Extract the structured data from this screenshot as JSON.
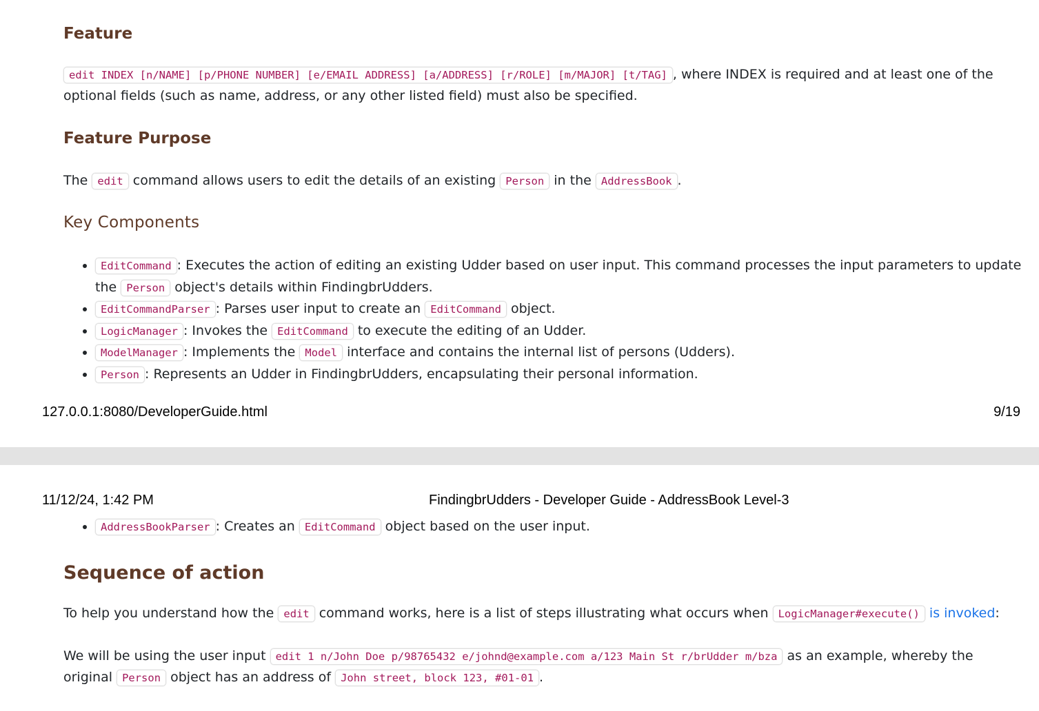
{
  "page1": {
    "feature_heading": "Feature",
    "feature_code": "edit INDEX [n/NAME] [p/PHONE NUMBER] [e/EMAIL ADDRESS] [a/ADDRESS] [r/ROLE] [m/MAJOR] [t/TAG]",
    "feature_text": ", where INDEX is required and at least one of the optional fields (such as name, address, or any other listed field) must also be specified.",
    "purpose_heading": "Feature Purpose",
    "purpose": {
      "t1": "The ",
      "c1": "edit",
      "t2": " command allows users to edit the details of an existing ",
      "c2": "Person",
      "t3": " in the ",
      "c3": "AddressBook",
      "t4": "."
    },
    "key_heading": "Key Components",
    "key_items": [
      {
        "c1": "EditCommand",
        "t1": ": Executes the action of editing an existing Udder based on user input. This command processes the input parameters to update the ",
        "c2": "Person",
        "t2": " object's details within FindingbrUdders."
      },
      {
        "c1": "EditCommandParser",
        "t1": ": Parses user input to create an ",
        "c2": "EditCommand",
        "t2": " object."
      },
      {
        "c1": "LogicManager",
        "t1": ": Invokes the ",
        "c2": "EditCommand",
        "t2": " to execute the editing of an Udder."
      },
      {
        "c1": "ModelManager",
        "t1": ": Implements the ",
        "c2": "Model",
        "t2": " interface and contains the internal list of persons (Udders)."
      },
      {
        "c1": "Person",
        "t1": ": Represents an Udder in FindingbrUdders, encapsulating their personal information."
      }
    ],
    "footer_url": "127.0.0.1:8080/DeveloperGuide.html",
    "footer_page": "9/19"
  },
  "page2": {
    "header_datetime": "11/12/24, 1:42 PM",
    "header_title": "FindingbrUdders - Developer Guide - AddressBook Level-3",
    "key_item": {
      "c1": "AddressBookParser",
      "t1": ": Creates an ",
      "c2": "EditCommand",
      "t2": " object based on the user input."
    },
    "sequence_heading": "Sequence of action",
    "seq_p1": {
      "t1": "To help you understand how the ",
      "c1": "edit",
      "t2": " command works, here is a list of steps illustrating what occurs when ",
      "c2": "LogicManager#execute()",
      "link": " is invoked",
      "t3": ":"
    },
    "seq_p2": {
      "t1": "We will be using the user input ",
      "c1": "edit 1 n/John Doe p/98765432 e/johnd@example.com a/123 Main St r/brUdder m/bza",
      "t2": " as an example, whereby the original ",
      "c2": "Person",
      "t3": " object has an address of ",
      "c3": "John street, block 123, #01-01",
      "t4": "."
    }
  }
}
